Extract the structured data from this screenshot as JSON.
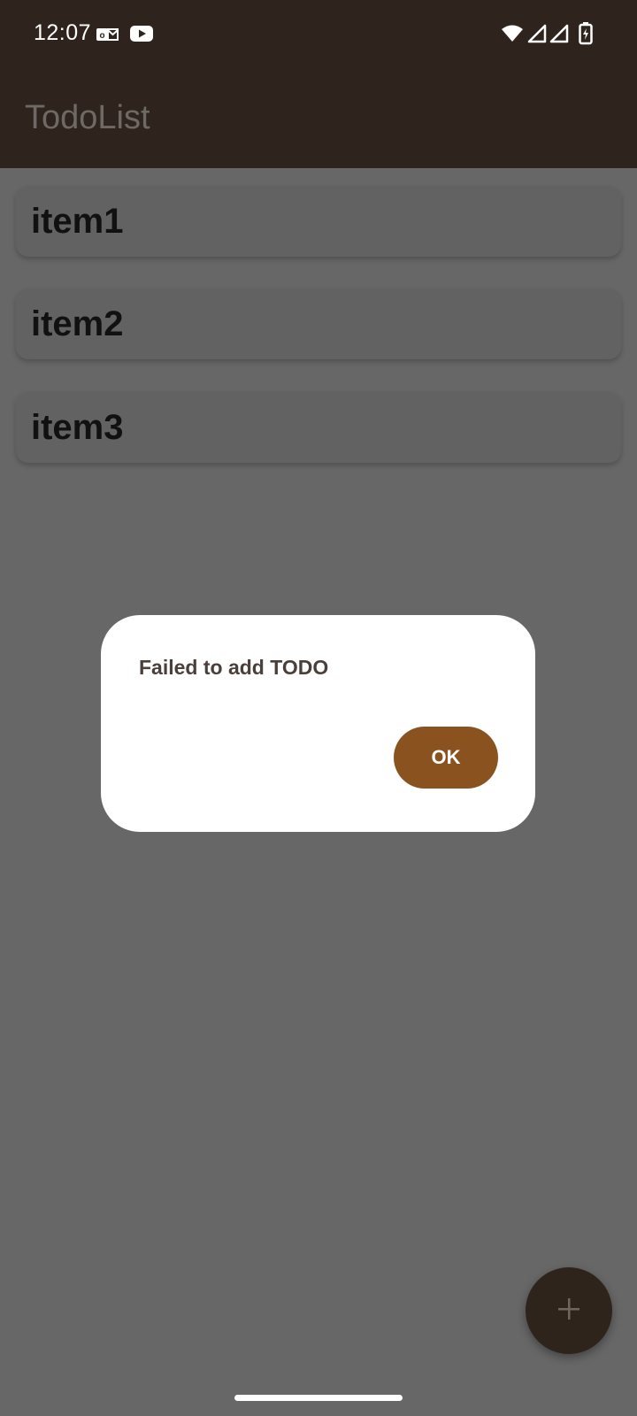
{
  "status_bar": {
    "time": "12:07",
    "left_icons": [
      "outlook-icon",
      "youtube-icon"
    ],
    "right_icons": [
      "wifi-icon",
      "signal-icon",
      "signal-icon",
      "battery-charging-icon"
    ]
  },
  "app_bar": {
    "title": "TodoList"
  },
  "todo_items": [
    {
      "label": "item1"
    },
    {
      "label": "item2"
    },
    {
      "label": "item3"
    }
  ],
  "dialog": {
    "message": "Failed to add TODO",
    "ok_label": "OK"
  },
  "fab": {
    "icon": "plus-icon"
  },
  "colors": {
    "app_bar": "#2e241d",
    "scrim_background": "#676767",
    "ok_button": "#8a521f",
    "fab": "#2f241c"
  }
}
